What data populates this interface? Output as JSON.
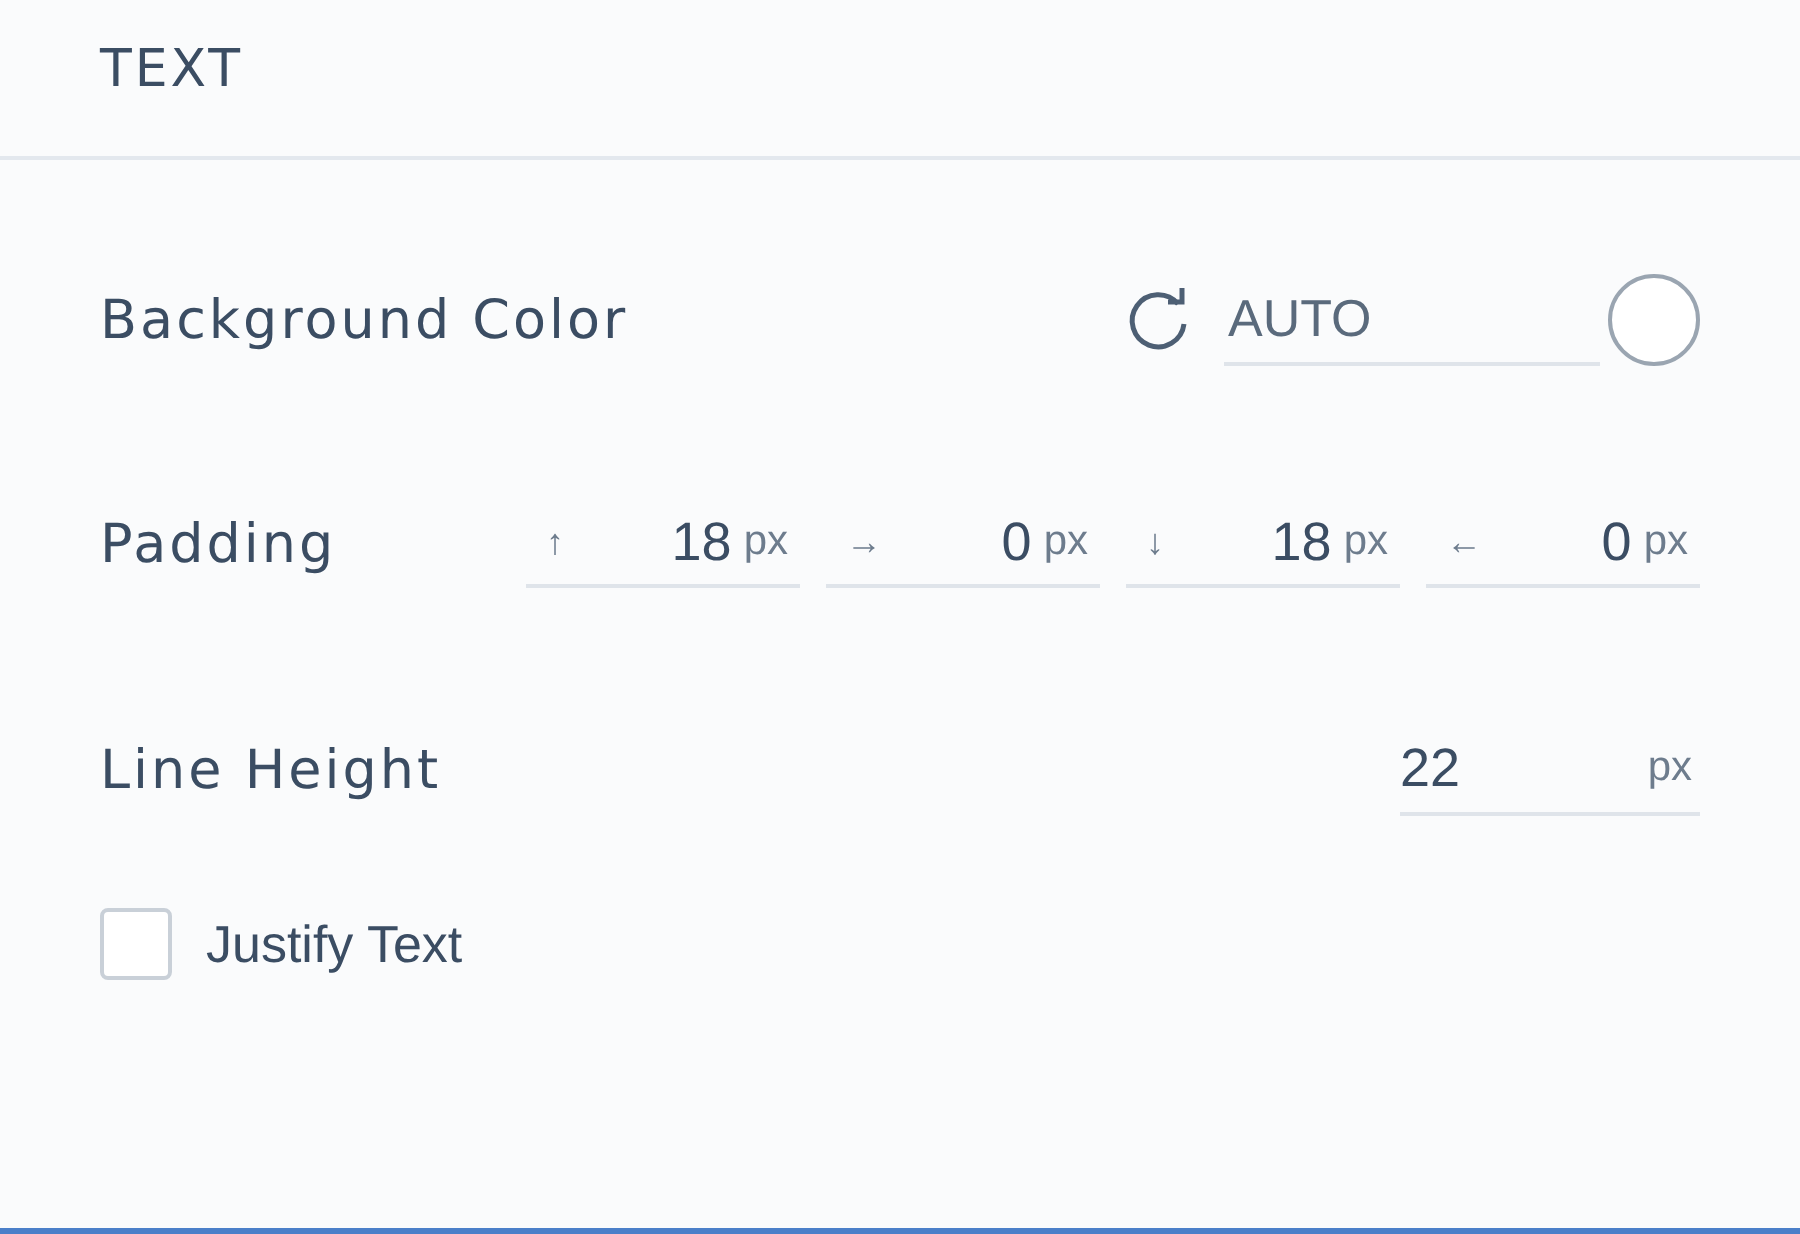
{
  "section": {
    "title": "TEXT"
  },
  "background_color": {
    "label": "Background Color",
    "value": "AUTO"
  },
  "padding": {
    "label": "Padding",
    "fields": [
      {
        "arrow": "↑",
        "value": "18",
        "unit": "px"
      },
      {
        "arrow": "→",
        "value": "0",
        "unit": "px"
      },
      {
        "arrow": "↓",
        "value": "18",
        "unit": "px"
      },
      {
        "arrow": "←",
        "value": "0",
        "unit": "px"
      }
    ]
  },
  "line_height": {
    "label": "Line Height",
    "value": "22",
    "unit": "px"
  },
  "justify": {
    "label": "Justify Text",
    "checked": false
  }
}
